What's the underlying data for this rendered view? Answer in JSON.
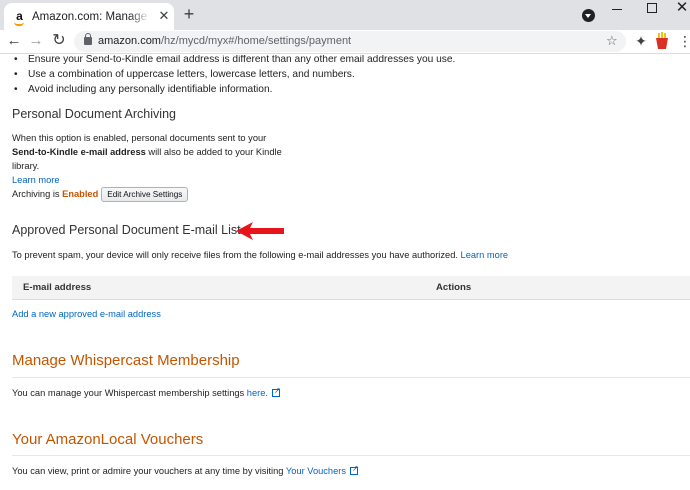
{
  "browser": {
    "tab_title": "Amazon.com: Manage Your Content and Devices",
    "tab_favicon": "a",
    "close_glyph": "✕",
    "new_tab_glyph": "+",
    "win_close_glyph": "✕",
    "back_glyph": "←",
    "forward_glyph": "→",
    "reload_glyph": "↻",
    "url_host": "amazon.com",
    "url_path": "/hz/mycd/myx#/home/settings/payment",
    "star_glyph": "☆",
    "puzzle_glyph": "✦",
    "menu_glyph": "⋮"
  },
  "bullets": [
    "Ensure your Send-to-Kindle email address is different than any other email addresses you use.",
    "Use a combination of uppercase letters, lowercase letters, and numbers.",
    "Avoid including any personally identifiable information."
  ],
  "archiving": {
    "heading": "Personal Document Archiving",
    "text_1": "When this option is enabled, personal documents sent to your",
    "text_bold": "Send-to-Kindle e-mail address",
    "text_2": " will also be added to your Kindle",
    "text_3": "library.",
    "learn_more": "Learn more",
    "status_prefix": "Archiving is ",
    "status_value": "Enabled",
    "edit_button": "Edit Archive Settings"
  },
  "approved_list": {
    "heading": "Approved Personal Document E-mail List",
    "description": "To prevent spam, your device will only receive files from the following e-mail addresses you have authorized.",
    "learn_more": "Learn more",
    "columns": [
      "E-mail address",
      "Actions"
    ],
    "add_link": "Add a new approved e-mail address"
  },
  "whispercast": {
    "heading": "Manage Whispercast Membership",
    "text": "You can manage your Whispercast membership settings ",
    "link": "here."
  },
  "vouchers": {
    "heading": "Your AmazonLocal Vouchers",
    "text": "You can view, print or admire your vouchers at any time by visiting ",
    "link": "Your Vouchers"
  },
  "colors": {
    "link": "#0066c0",
    "accent_orange": "#c45500",
    "annotation_arrow": "#e8141c"
  }
}
